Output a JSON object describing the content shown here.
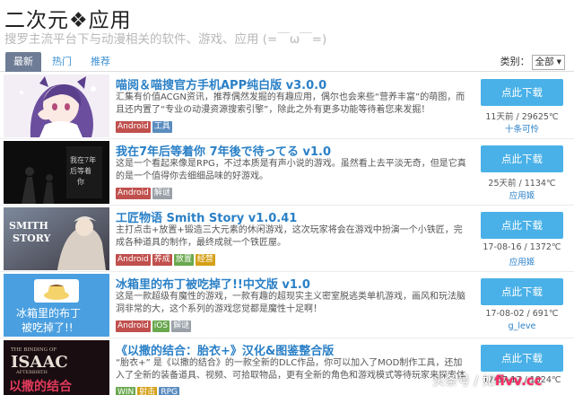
{
  "header": {
    "title": "二次元❖应用",
    "subtitle": "搜罗主流平台下与动漫相关的软件、游戏、应用 (=￣ω￣=)"
  },
  "tabs": [
    {
      "label": "最新",
      "active": true
    },
    {
      "label": "热门",
      "active": false
    },
    {
      "label": "推荐",
      "active": false
    }
  ],
  "category": {
    "label": "类别：",
    "selected": "全部"
  },
  "colors": {
    "accent": "#4ab1e8",
    "link": "#2a80c7",
    "tab_active": "#6e7c95",
    "tags": {
      "Android": "#c0504d",
      "工具": "#5a8cbf",
      "解谜": "#9aa0a8",
      "养成": "#c0504d",
      "放置": "#6aa84f",
      "经营": "#d4a017",
      "iOS": "#6aa84f",
      "WIN": "#6aa84f",
      "射击": "#d4a017",
      "RPG": "#5a8cbf"
    }
  },
  "items": [
    {
      "title": "喵阅＆喵搜官方手机APP纯白版 v3.0.0",
      "desc": "汇集有价值ACGN资讯，推荐偶然发掘的有趣应用，偶尔也会来些“营养丰富”的萌图，而且还内置了“专业の动漫资源搜索引擎”，除此之外有更多功能等待着您来发掘！",
      "tags": [
        "Android",
        "工具"
      ],
      "meta": "11天前 / 29625℃",
      "author": "十条可怜",
      "thumb_text": ""
    },
    {
      "title": "我在7年后等着你 7年後で待ってる v1.0",
      "desc": "这是一个看起来像是RPG，不过本质是有声小说的游戏。虽然看上去平淡无奇，但是它真的是一个值得你去细细品味的好游戏。",
      "tags": [
        "Android",
        "解谜"
      ],
      "meta": "25天前 / 1134℃",
      "author": "应用姬",
      "thumb_text": "我在7年后等着你"
    },
    {
      "title": "工匠物语 Smith Story v1.0.41",
      "desc": "主打点击+放置+锻造三大元素的休闲游戏，这次玩家将会在游戏中扮演一个小铁匠，完成各种道具的制作，最终成就一个铁匠屋。",
      "tags": [
        "Android",
        "养成",
        "放置",
        "经营"
      ],
      "meta": "17-08-16 / 1372℃",
      "author": "应用姬",
      "thumb_text": "SMITH STORY"
    },
    {
      "title": "冰箱里的布丁被吃掉了!!中文版 v1.0",
      "desc": "这是一款超级有魔性的游戏，一款有趣的超现实主义密室脱逃类单机游戏，画风和玩法脑洞非常的大，这个系列的游戏您觉都是魔性十足啊！",
      "tags": [
        "Android",
        "iOS",
        "解谜"
      ],
      "meta": "17-08-02 / 691℃",
      "author": "g_leve",
      "thumb_text": "冰箱里的布丁被吃掉了!!"
    },
    {
      "title": "《以撒的结合：胎衣+》汉化&图鉴整合版",
      "desc": "“胎衣+” 是《以撒的结合》的一款全新的DLC作品，你可以加入了MOD制作工具，还加入了全新的装备道具、视频、可拾取物品，更有全新的角色和游戏模式等待玩家来探索体验。",
      "tags": [
        "WIN",
        "射击",
        "RPG"
      ],
      "meta": "17-07-17 / 1824℃",
      "author": "",
      "thumb_text": "ISAAC 以撒的结合 胎衣"
    }
  ],
  "download_label": "点此下载",
  "watermark": {
    "text": "头条号 / 如",
    "brand": "fivv.cc"
  }
}
